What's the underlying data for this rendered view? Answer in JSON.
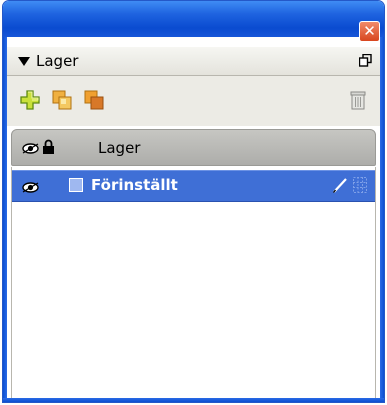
{
  "window": {
    "close_glyph": "✕"
  },
  "panel": {
    "title": "Lager",
    "menu_icon": "panel-menu-icon"
  },
  "toolbar": {
    "tools": [
      "add-layer-icon",
      "duplicate-layer-icon",
      "merge-layers-icon",
      "delete-layer-icon"
    ]
  },
  "layers_header": {
    "label": "Lager",
    "icons": [
      "visibility-eye-icon",
      "lock-icon"
    ]
  },
  "layers": [
    {
      "name": "Förinställt",
      "selected": true,
      "swatch_color": "#9fb8f0",
      "icons": [
        "visibility-eye-icon",
        "pen-icon",
        "grid-icon"
      ]
    }
  ],
  "colors": {
    "titlebar": "#0a4bd0",
    "selection": "#3f6fd6",
    "close_button": "#d8461e"
  }
}
